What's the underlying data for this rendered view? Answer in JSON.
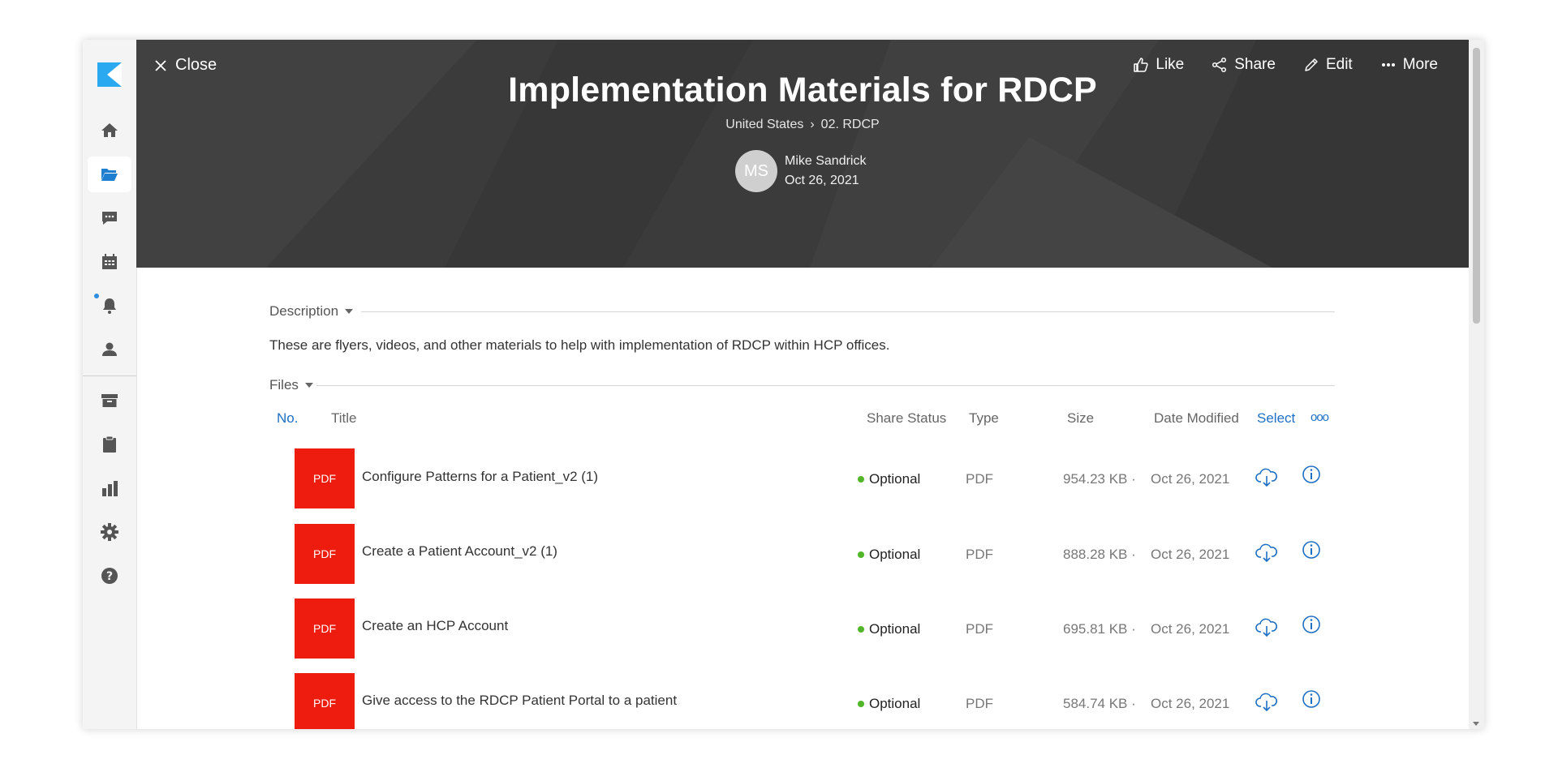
{
  "header": {
    "close_label": "Close",
    "title": "Implementation Materials for RDCP",
    "breadcrumb": [
      "United States",
      "02. RDCP"
    ],
    "breadcrumb_separator": "›",
    "author": {
      "initials": "MS",
      "name": "Mike Sandrick",
      "date": "Oct 26, 2021"
    },
    "actions": {
      "like": "Like",
      "share": "Share",
      "edit": "Edit",
      "more": "More"
    }
  },
  "sidebar": {
    "items": [
      {
        "icon": "home-icon"
      },
      {
        "icon": "folder-open-icon",
        "active": true
      },
      {
        "icon": "chat-icon"
      },
      {
        "icon": "calendar-icon"
      },
      {
        "icon": "bell-icon"
      },
      {
        "icon": "user-icon"
      },
      {
        "icon": "archive-icon"
      },
      {
        "icon": "clipboard-icon"
      },
      {
        "icon": "bar-chart-icon"
      },
      {
        "icon": "gear-icon"
      },
      {
        "icon": "help-icon"
      }
    ]
  },
  "description": {
    "heading": "Description",
    "text": "These are flyers, videos, and other materials to help with implementation of RDCP within HCP offices."
  },
  "files": {
    "heading": "Files",
    "columns": {
      "no": "No.",
      "title": "Title",
      "share_status": "Share Status",
      "type": "Type",
      "size": "Size",
      "date_modified": "Date Modified",
      "select": "Select",
      "more": "ooo"
    },
    "rows": [
      {
        "thumb": "PDF",
        "title": "Configure Patterns for a Patient_v2 (1)",
        "status": "Optional",
        "type": "PDF",
        "size": "954.23 KB ·",
        "date": "Oct 26, 2021"
      },
      {
        "thumb": "PDF",
        "title": "Create a Patient Account_v2 (1)",
        "status": "Optional",
        "type": "PDF",
        "size": "888.28 KB ·",
        "date": "Oct 26, 2021"
      },
      {
        "thumb": "PDF",
        "title": "Create an HCP Account",
        "status": "Optional",
        "type": "PDF",
        "size": "695.81 KB ·",
        "date": "Oct 26, 2021"
      },
      {
        "thumb": "PDF",
        "title": "Give access to the RDCP Patient Portal to a patient",
        "status": "Optional",
        "type": "PDF",
        "size": "584.74 KB ·",
        "date": "Oct 26, 2021"
      }
    ]
  },
  "colors": {
    "banner": "#3b3b3b",
    "accent": "#1f6fc4",
    "pdf": "#ee1c0e",
    "status_dot": "#52b52a"
  }
}
